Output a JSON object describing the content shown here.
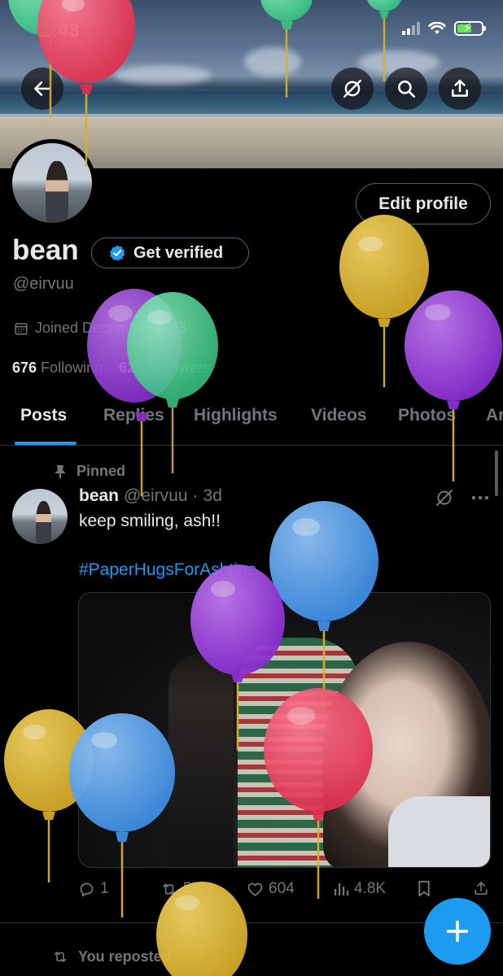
{
  "status_bar": {
    "time": "2:43"
  },
  "profile": {
    "name": "bean",
    "verify_label": "Get verified",
    "handle": "@eirvuu",
    "joined": "Joined December 2023",
    "following_count": "676",
    "following_label": "Following",
    "followers_count": "625",
    "followers_label": "Followers",
    "edit_label": "Edit profile"
  },
  "tabs": [
    {
      "label": "Posts",
      "active": true
    },
    {
      "label": "Replies",
      "active": false
    },
    {
      "label": "Highlights",
      "active": false
    },
    {
      "label": "Videos",
      "active": false
    },
    {
      "label": "Photos",
      "active": false
    },
    {
      "label": "Ar",
      "active": false
    }
  ],
  "post": {
    "pinned_label": "Pinned",
    "author_name": "bean",
    "author_handle": "@eirvuu",
    "separator": "·",
    "age": "3d",
    "text": "keep smiling, ash!!",
    "hashtag": "#PaperHugsForAshtine",
    "stats": {
      "replies": "1",
      "reposts": "58",
      "likes": "604",
      "views": "4.8K"
    }
  },
  "next_item": {
    "reposted_label": "You reposted"
  },
  "colors": {
    "accent": "#1d9bf0",
    "muted": "#71767b",
    "text": "#e7e9ea",
    "background": "#000000"
  },
  "icons": {
    "back": "arrow-left-icon",
    "grok": "grok-icon",
    "search": "search-icon",
    "share": "share-icon",
    "verified": "verified-badge-icon",
    "calendar": "calendar-icon",
    "pin": "pin-icon",
    "reply": "reply-icon",
    "repost": "repost-icon",
    "like": "heart-icon",
    "views": "views-icon",
    "bookmark": "bookmark-icon",
    "compose": "plus-icon"
  }
}
